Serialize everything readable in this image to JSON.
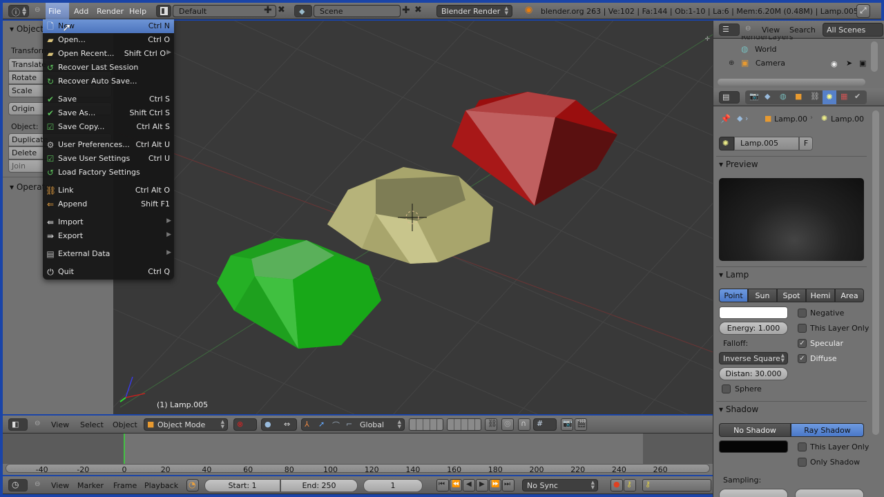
{
  "top_bar": {
    "menus": [
      "File",
      "Add",
      "Render",
      "Help"
    ],
    "screen_layout": "Default",
    "scene": "Scene",
    "render_engine": "Blender Render",
    "stats": "blender.org 263 | Ve:102 | Fa:144 | Ob:1-10 | La:6 | Mem:6.20M (0.48M) | Lamp.005"
  },
  "file_menu": {
    "items": [
      {
        "label": "New",
        "shortcut": "Ctrl N",
        "icon": "new-file-icon",
        "highlighted": true
      },
      {
        "label": "Open...",
        "shortcut": "Ctrl O",
        "icon": "folder-icon"
      },
      {
        "label": "Open Recent...",
        "shortcut": "Shift Ctrl O",
        "icon": "recent-folder-icon",
        "submenu": true
      },
      {
        "label": "Recover Last Session",
        "shortcut": "",
        "icon": "recover-icon"
      },
      {
        "label": "Recover Auto Save...",
        "shortcut": "",
        "icon": "recover-auto-icon"
      },
      {
        "label": "Save",
        "shortcut": "Ctrl S",
        "icon": "check-icon"
      },
      {
        "label": "Save As...",
        "shortcut": "Shift Ctrl S",
        "icon": "check-dots-icon"
      },
      {
        "label": "Save Copy...",
        "shortcut": "Ctrl Alt S",
        "icon": "save-copy-icon"
      },
      {
        "label": "User Preferences...",
        "shortcut": "Ctrl Alt U",
        "icon": "preferences-icon"
      },
      {
        "label": "Save User Settings",
        "shortcut": "Ctrl U",
        "icon": "save-settings-icon"
      },
      {
        "label": "Load Factory Settings",
        "shortcut": "",
        "icon": "factory-icon"
      },
      {
        "label": "Link",
        "shortcut": "Ctrl Alt O",
        "icon": "link-icon"
      },
      {
        "label": "Append",
        "shortcut": "Shift F1",
        "icon": "append-icon"
      },
      {
        "label": "Import",
        "shortcut": "",
        "icon": "import-icon",
        "submenu": true
      },
      {
        "label": "Export",
        "shortcut": "",
        "icon": "export-icon",
        "submenu": true
      },
      {
        "label": "External Data",
        "shortcut": "",
        "icon": "external-data-icon",
        "submenu": true
      },
      {
        "label": "Quit",
        "shortcut": "Ctrl Q",
        "icon": "power-icon"
      }
    ]
  },
  "tool_shelf": {
    "object_header": "Object",
    "transform_label": "Transform:",
    "buttons_transform": [
      "Translate",
      "Rotate",
      "Scale"
    ],
    "origin_button": "Origin",
    "object_label": "Object:",
    "buttons_object": [
      "Duplicate",
      "Delete",
      "Join"
    ],
    "operator_header": "Operator"
  },
  "viewport": {
    "object_label": "(1) Lamp.005",
    "header": {
      "menus": [
        "View",
        "Select",
        "Object"
      ],
      "mode": "Object Mode",
      "orientation": "Global"
    }
  },
  "outliner": {
    "menus": [
      "View",
      "Search"
    ],
    "filter": "All Scenes",
    "items": [
      "RenderLayers",
      "World",
      "Camera"
    ]
  },
  "properties": {
    "breadcrumb": [
      "Lamp.00",
      "Lamp.00"
    ],
    "datablock_name": "Lamp.005",
    "datablock_fake": "F",
    "preview_header": "Preview",
    "lamp_header": "Lamp",
    "lamp_types": [
      "Point",
      "Sun",
      "Spot",
      "Hemi",
      "Area"
    ],
    "lamp_type_selected": "Point",
    "energy": "Energy: 1.000",
    "falloff_label": "Falloff:",
    "falloff": "Inverse Square",
    "distance": "Distan: 30.000",
    "sphere": "Sphere",
    "negative": "Negative",
    "this_layer_only": "This Layer Only",
    "specular": "Specular",
    "diffuse": "Diffuse",
    "negative_checked": false,
    "this_layer_only_checked": false,
    "specular_checked": true,
    "diffuse_checked": true,
    "sphere_checked": false,
    "shadow_header": "Shadow",
    "shadow_types": [
      "No Shadow",
      "Ray Shadow"
    ],
    "shadow_selected": "Ray Shadow",
    "shadow_this_layer_only": "This Layer Only",
    "only_shadow": "Only Shadow",
    "sampling_label": "Sampling:"
  },
  "timeline": {
    "ticks": [
      "-40",
      "-20",
      "0",
      "20",
      "40",
      "60",
      "80",
      "100",
      "120",
      "140",
      "160",
      "180",
      "200",
      "220",
      "240",
      "260"
    ],
    "current_frame_marker": 0,
    "menus": [
      "View",
      "Marker",
      "Frame",
      "Playback"
    ],
    "start": "Start: 1",
    "end": "End: 250",
    "current_frame": "1",
    "sync": "No Sync"
  },
  "colors": {
    "accent_blue": "#5680c8",
    "window_border": "#1a44a8",
    "menu_bg": "#161616",
    "viewport_bg": "#393939",
    "panel_bg": "#727272",
    "gem_red": "#a01010",
    "gem_yellow": "#b8b67a",
    "gem_green": "#1ea81e"
  }
}
